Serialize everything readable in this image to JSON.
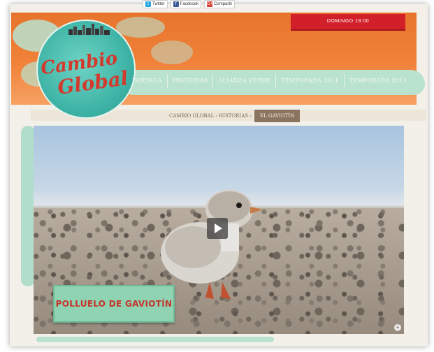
{
  "share": {
    "twitter": "Twitter",
    "facebook": "Facebook",
    "gplus_icon": "G+",
    "gplus_label": "Compartir"
  },
  "schedule": {
    "text": "DOMINGO 19:00"
  },
  "logo": {
    "line1": "Cambio",
    "line2": "Global"
  },
  "nav": {
    "items": [
      {
        "label": "PORTADA"
      },
      {
        "label": "HISTORIAS"
      },
      {
        "label": "ALIANZA VERDE"
      },
      {
        "label": "TEMPORADA 2011"
      },
      {
        "label": "TEMPORADA 2013"
      }
    ]
  },
  "breadcrumb": {
    "items": [
      "CAMBIO GLOBAL",
      "HISTORIAS"
    ],
    "separator": "›",
    "current": "EL GAVIOTÍN"
  },
  "video": {
    "caption": "POLLUELO DE GAVIOTÍN",
    "expand_icon": "+"
  },
  "colors": {
    "header_orange": "#f0823a",
    "accent_teal": "#b9e2cf",
    "schedule_red": "#d2202b",
    "caption_red": "#c6322a"
  },
  "icons": [
    "twitter-icon",
    "facebook-icon",
    "google-plus-icon",
    "play-icon",
    "expand-icon"
  ]
}
